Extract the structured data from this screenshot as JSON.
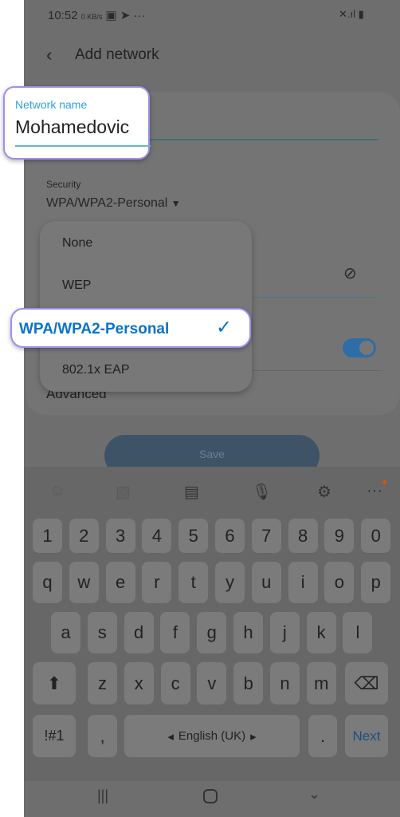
{
  "status": {
    "time": "10:52",
    "speed": "0 KB/s",
    "icons": [
      "image-icon",
      "telegram-icon",
      "more-icon"
    ],
    "right_icons": [
      "mute-icon",
      "signal-icon",
      "battery-icon"
    ]
  },
  "header": {
    "title": "Add network",
    "back_icon": "back-icon"
  },
  "network_name": {
    "label": "Network name",
    "value": "Mohamedovic"
  },
  "security": {
    "label": "Security",
    "value": "WPA/WPA2-Personal"
  },
  "menu": {
    "items": [
      {
        "label": "None"
      },
      {
        "label": "WEP"
      },
      {
        "label": "WPA/WPA2-Personal",
        "selected": true
      },
      {
        "label": "802.1x EAP"
      }
    ]
  },
  "advanced_label": "Advanced",
  "save_label": "Save",
  "toggle": {
    "on": true
  },
  "keyboard": {
    "toolbar": [
      "emoji-icon",
      "sticker-icon",
      "clipboard-icon",
      "mic-icon",
      "gear-icon",
      "more-icon"
    ],
    "row1": [
      "1",
      "2",
      "3",
      "4",
      "5",
      "6",
      "7",
      "8",
      "9",
      "0"
    ],
    "row2": [
      "q",
      "w",
      "e",
      "r",
      "t",
      "y",
      "u",
      "i",
      "o",
      "p"
    ],
    "row3": [
      "a",
      "s",
      "d",
      "f",
      "g",
      "h",
      "j",
      "k",
      "l"
    ],
    "row4": [
      "z",
      "x",
      "c",
      "v",
      "b",
      "n",
      "m"
    ],
    "symbols": "!#1",
    "comma": ",",
    "space": "English (UK)",
    "period": ".",
    "next": "Next"
  },
  "colors": {
    "accent": "#0a73c9",
    "highlight_border": "#9b8ff0",
    "label_blue": "#2ea0e0"
  }
}
